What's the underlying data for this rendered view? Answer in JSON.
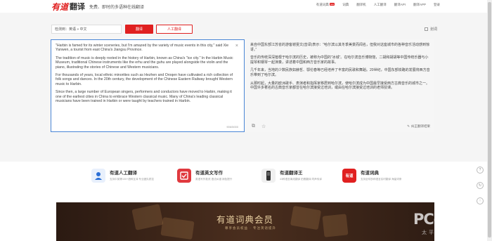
{
  "header": {
    "logo_red": "有道",
    "logo_dark": "翻译",
    "slogan": "免费、即时的多语种在线翻译",
    "nav": [
      {
        "label": "有道词典",
        "badge": "new"
      },
      {
        "label": "词典"
      },
      {
        "label": "翻译机"
      },
      {
        "label": "人工翻译"
      },
      {
        "label": "翻译API"
      },
      {
        "label": "翻译APP"
      },
      {
        "label": "登录"
      }
    ]
  },
  "toolbar": {
    "lang_label": "检测到：英语 » 中文",
    "translate_label": "翻译",
    "human_label": "人工翻译",
    "bilingual_label": "划词"
  },
  "source": {
    "paragraphs": [
      "\"Harbin is famed for its winter sceneries, but I'm amazed by the variety of music events in this city,\" said Xie Yanwen, a tourist from east China's Jiangsu Province.",
      "The tradition of music is deeply rooted in the history of Harbin, known as China's \"ice city.\" In the Harbin Music Museum, traditional Chinese instruments like the erhu and the guhu are played alongside the violin and the piano, illustrating the stories of Chinese and Western musicians.",
      "For thousands of years, local ethnic minorities such as Hezhen and Oroqen have cultivated a rich collection of folk songs and dances. In the 20th century, the development of the Chinese Eastern Railway brought Western music to Harbin.",
      "Since then, a large number of European singers, performers and conductors have moved to Harbin, making it one of the earliest cities in China to embrace Western classical music. Many of China's leading classical musicians have been trained in Harbin or were taught by teachers trained in Harbin."
    ],
    "close": "×",
    "counter": "906/5000"
  },
  "target": {
    "paragraphs": [
      "来自中国东部江苏省的游客谢雯文(音译)表示：“哈尔滨以其冬季美景而闻名，但我对这座城市的各种音乐活动感到惊讶。”",
      "音乐的传统深深植根于哈尔滨的历史，被称为中国的“冰城”。在哈尔滨音乐博物馆，二胡和胡胡等中国传统乐器与小提琴和钢琴一起演奏，讲述着中国和西方音乐家的故事。",
      "几千年来，当地的少数民族如赫哲、鄂伦春等已经培养了丰富的民歌和舞蹈。20世纪，中国东部铁路的发展将西方音乐带到了哈尔滨。",
      "从那时起，大量的欧洲歌手、表演者和指挥家移居到哈尔滨，使哈尔滨成为中国最早接受西方古典音乐的城市之一。中国许多著名的古典音乐家都曾在哈尔滨接受过培训，或由在哈尔滨接受过培训的老师授课。"
    ],
    "fix_label": "纠正翻译结果"
  },
  "products": [
    {
      "title": "有道人工翻译",
      "desc": "支持中英等100+语种互译 专业团队质控",
      "color": "#2a6fd6",
      "glyph": "人"
    },
    {
      "title": "有道英文写作",
      "desc": "英语写作批改 语法纠错 润色提升",
      "color": "#e0393e",
      "glyph": "✓"
    },
    {
      "title": "有道翻译王",
      "desc": "43种语言离线翻译 拍照翻译 同声传译",
      "color": "#333333",
      "glyph": "▮"
    },
    {
      "title": "有道词典",
      "desc": "支持全球多种语言实时翻译 海量词条",
      "color": "#e02020",
      "glyph": "有道"
    }
  ],
  "banner": {
    "title": "有道词典会员",
    "subtitle": "尊享会员权益 · 专注英语提升"
  },
  "watermark": {
    "main": "PConline",
    "sub": "太平洋电脑网"
  }
}
